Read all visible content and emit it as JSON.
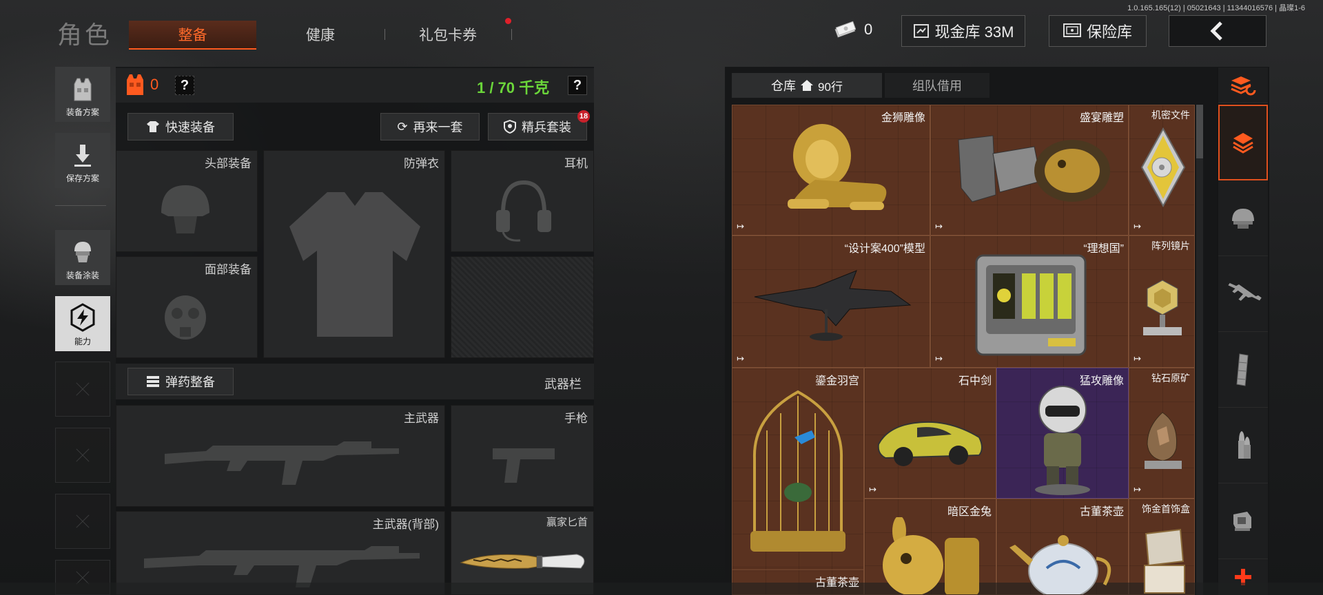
{
  "version": "1.0.165.165(12) | 05021643 | 11344016576 | 晶璨1-6",
  "header": {
    "title": "角色",
    "tabs": [
      {
        "label": "整备",
        "active": true
      },
      {
        "label": "健康",
        "active": false
      },
      {
        "label": "礼包卡券",
        "active": false,
        "has_notification": true
      }
    ],
    "cash_count": "0",
    "cash_vault_label": "现金库 33M",
    "insurance_label": "保险库",
    "back_icon": "back-arrow-icon"
  },
  "sidebar": {
    "items": [
      {
        "label": "装备方案",
        "icon": "vest-icon"
      },
      {
        "label": "保存方案",
        "icon": "download-icon"
      },
      {
        "label": "装备涂装",
        "icon": "soldier-head-icon"
      },
      {
        "label": "能力",
        "icon": "ability-icon",
        "active": true
      }
    ]
  },
  "loadout": {
    "armor_count": "0",
    "unknown_mark": "?",
    "weight": "1 / 70 千克",
    "weight_help": "?",
    "quick_equip_label": "快速装备",
    "again_label": "再来一套",
    "elite_label": "精兵套装",
    "elite_badge": "18",
    "slots": {
      "head": "头部装备",
      "armor": "防弹衣",
      "headset": "耳机",
      "face": "面部装备"
    },
    "ammo_label": "弹药整备",
    "weapon_bar_label": "武器栏",
    "weapon_slots": {
      "primary": "主武器",
      "pistol": "手枪",
      "primary_back": "主武器(背部)",
      "knife": "赢家匕首"
    }
  },
  "warehouse": {
    "tab_storage": "仓库",
    "rows": "90行",
    "tab_team": "组队借用",
    "items": [
      {
        "name": "金狮雕像"
      },
      {
        "name": "盛宴雕塑"
      },
      {
        "name": "机密文件"
      },
      {
        "name": "“设计案400”模型"
      },
      {
        "name": "“理想国”"
      },
      {
        "name": "阵列镜片"
      },
      {
        "name": "鎏金羽宫"
      },
      {
        "name": "石中剑"
      },
      {
        "name": "猛攻雕像"
      },
      {
        "name": "钻石原矿"
      },
      {
        "name": "暗区金兔"
      },
      {
        "name": "古董茶壶"
      },
      {
        "name": "饰金首饰盒"
      },
      {
        "name": "古董茶壶"
      }
    ]
  },
  "category_bar": {
    "items": [
      {
        "icon": "sort-stack-icon"
      },
      {
        "icon": "all-items-icon",
        "active": true
      },
      {
        "icon": "helmet-icon"
      },
      {
        "icon": "rifle-icon"
      },
      {
        "icon": "magazine-icon"
      },
      {
        "icon": "bullet-icon"
      },
      {
        "icon": "scope-icon"
      },
      {
        "icon": "plus-icon"
      }
    ]
  },
  "colors": {
    "accent": "#ff5a1f",
    "weight_green": "#6bd63a",
    "item_bg": "#5a3220",
    "purple_item_bg": "#3b2556"
  }
}
